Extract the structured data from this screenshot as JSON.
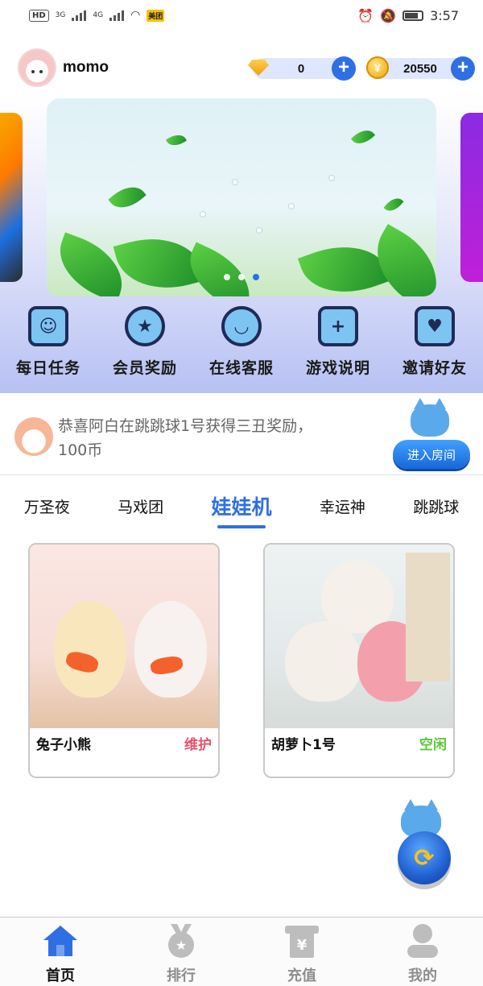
{
  "status_bar": {
    "hd": "HD",
    "net1": "3G",
    "net2": "4G",
    "app_badge": "美团",
    "time": "3:57"
  },
  "user": {
    "name": "momo",
    "diamonds": "0",
    "coins": "20550"
  },
  "icons": {
    "diamond": "diamond-icon",
    "coin": "coin-icon",
    "add": "plus-icon"
  },
  "banner": {
    "slide_count": 3,
    "active_slide": 2
  },
  "menu": [
    {
      "label": "每日任务",
      "icon": "daily-task-icon"
    },
    {
      "label": "会员奖励",
      "icon": "member-reward-icon"
    },
    {
      "label": "在线客服",
      "icon": "customer-service-icon"
    },
    {
      "label": "游戏说明",
      "icon": "game-guide-icon"
    },
    {
      "label": "邀请好友",
      "icon": "invite-friend-icon"
    }
  ],
  "notice": {
    "text": "恭喜阿白在跳跳球1号获得三丑奖励，100币",
    "button": "进入房间"
  },
  "tabs": [
    {
      "label": "万圣夜",
      "active": false
    },
    {
      "label": "马戏团",
      "active": false
    },
    {
      "label": "娃娃机",
      "active": true
    },
    {
      "label": "幸运神",
      "active": false
    },
    {
      "label": "跳跳球",
      "active": false
    }
  ],
  "products": [
    {
      "name": "兔子小熊",
      "status": "维护",
      "status_color": "#e8506a"
    },
    {
      "name": "胡萝卜1号",
      "status": "空闲",
      "status_color": "#5cc83a"
    }
  ],
  "bottom_nav": [
    {
      "label": "首页",
      "icon": "home-icon",
      "active": true
    },
    {
      "label": "排行",
      "icon": "medal-icon",
      "active": false
    },
    {
      "label": "充值",
      "icon": "recharge-icon",
      "active": false
    },
    {
      "label": "我的",
      "icon": "profile-icon",
      "active": false
    }
  ],
  "colors": {
    "accent": "#2f6fe4",
    "inactive_nav": "#bdbdbd"
  }
}
